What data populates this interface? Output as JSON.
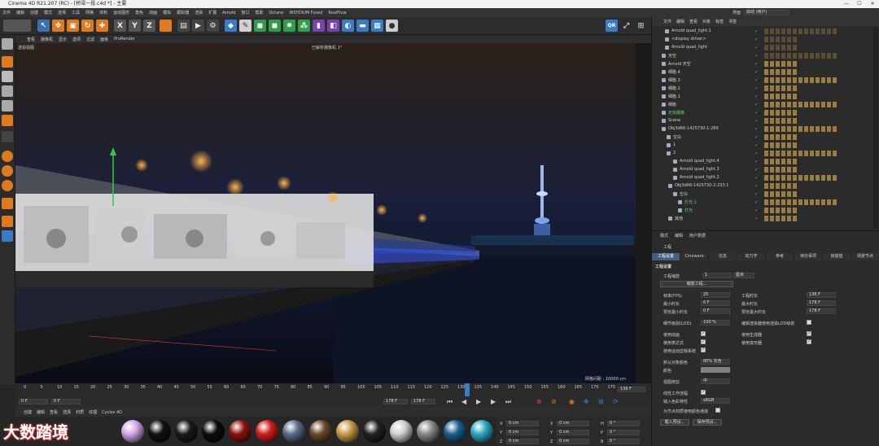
{
  "window": {
    "title": "Cinema 4D R21.207 (RC) - [桥梁一段.c4d *] - 主要",
    "controls": [
      "—",
      "☐",
      "✕"
    ]
  },
  "menubar": [
    "文件",
    "编辑",
    "创建",
    "模式",
    "选择",
    "工具",
    "网格",
    "体积",
    "运动图形",
    "角色",
    "动画",
    "模拟",
    "跟踪器",
    "渲染",
    "扩展",
    "Arnold",
    "窗口",
    "帮助",
    "Octane",
    "INSYDIUM Fused",
    "RealFlow"
  ],
  "layout": {
    "label": "界面",
    "value": "启动 (用户)"
  },
  "viewport": {
    "menu": [
      "查看",
      "摄像机",
      "显示",
      "选项",
      "过滤",
      "面板",
      "ProRender"
    ],
    "view_name": "透视视图",
    "camera_label": "已解析摄像机 1°",
    "grid_label": "网格间距 : 10000 cm"
  },
  "timeline": {
    "ticks": [
      "0",
      "5",
      "10",
      "15",
      "20",
      "25",
      "30",
      "35",
      "40",
      "45",
      "50",
      "55",
      "60",
      "65",
      "70",
      "75",
      "80",
      "85",
      "90",
      "95",
      "100",
      "105",
      "110",
      "115",
      "120",
      "125",
      "130",
      "135",
      "140",
      "145",
      "150",
      "155",
      "160",
      "165",
      "170",
      "175"
    ],
    "current_frame": "136 F"
  },
  "transport": {
    "start": "0 F",
    "start2": "0 F",
    "end": "178 F",
    "end2": "178 F"
  },
  "material_menu": [
    "创建",
    "编辑",
    "查看",
    "选择",
    "材质",
    "纹理",
    "Cycles 4D"
  ],
  "materials": [
    {
      "color": "#cfa8e6"
    },
    {
      "color": "#111"
    },
    {
      "color": "#1a1a1a"
    },
    {
      "color": "#0d0d0d"
    },
    {
      "color": "#8c1111"
    },
    {
      "color": "#d21e1e"
    },
    {
      "color": "#5a6d8a"
    },
    {
      "color": "#6a4a2a"
    },
    {
      "color": "#c89a44"
    },
    {
      "color": "#222"
    },
    {
      "color": "#d0d0d0"
    },
    {
      "color": "#888"
    },
    {
      "color": "#1b5f8f"
    },
    {
      "color": "#2aa9c4"
    }
  ],
  "coords": {
    "x": "X",
    "y": "Y",
    "z": "Z",
    "h": "H",
    "p": "P",
    "b": "B",
    "val": "0 cm",
    "angle": "0 °"
  },
  "watermark": "大数踏境",
  "object_manager": {
    "tabs": [
      "文件",
      "编辑",
      "查看",
      "对象",
      "标签",
      "书签"
    ],
    "rows": [
      {
        "name": "Arnold quad_light.1",
        "indent": 10,
        "green": false
      },
      {
        "name": "<display driver>",
        "indent": 10,
        "green": false
      },
      {
        "name": "Arnold quad_light",
        "indent": 10,
        "green": false
      },
      {
        "name": "天空",
        "indent": 6,
        "green": false
      },
      {
        "name": "Arnold 天空",
        "indent": 6,
        "green": false
      },
      {
        "name": "细胞.4",
        "indent": 6,
        "green": false
      },
      {
        "name": "细胞.3",
        "indent": 6,
        "green": false
      },
      {
        "name": "细胞.2",
        "indent": 6,
        "green": false
      },
      {
        "name": "细胞.1",
        "indent": 6,
        "green": false
      },
      {
        "name": "细胞",
        "indent": 6,
        "green": false
      },
      {
        "name": "无标摄像",
        "indent": 6,
        "green": true
      },
      {
        "name": "Scene",
        "indent": 6,
        "green": false
      },
      {
        "name": "Obj3d66-1425730-1-289",
        "indent": 6,
        "green": false
      },
      {
        "name": "空白",
        "indent": 12,
        "green": false
      },
      {
        "name": "1",
        "indent": 12,
        "green": false
      },
      {
        "name": "2",
        "indent": 12,
        "green": false
      },
      {
        "name": "Arnold quad_light.4",
        "indent": 20,
        "green": false
      },
      {
        "name": "Arnold quad_light.3",
        "indent": 20,
        "green": false
      },
      {
        "name": "Arnold quad_light.2",
        "indent": 20,
        "green": false
      },
      {
        "name": "Obj3d66-1425730-2-233.1",
        "indent": 14,
        "green": false
      },
      {
        "name": "空白",
        "indent": 20,
        "green": false
      },
      {
        "name": "灯光.1",
        "indent": 26,
        "green": true
      },
      {
        "name": "灯光",
        "indent": 26,
        "green": true
      },
      {
        "name": "其他",
        "indent": 14,
        "green": false
      }
    ]
  },
  "attributes": {
    "menu": [
      "模式",
      "编辑",
      "用户数据"
    ],
    "title": "工程",
    "tabs": [
      "工程设置",
      "Cineware",
      "信息",
      "动力学",
      "参考",
      "待办事项",
      "帧插值",
      "场景节点"
    ],
    "section": "工程设置",
    "fields": {
      "scale_label": "工程缩放",
      "scale_value": "1",
      "scale_unit": "厘米",
      "scale_btn": "缩放工程...",
      "fps_label": "帧率(FPS)",
      "fps_value": "25",
      "time_label": "工程时长",
      "time_value": "136 F",
      "min_label": "最小时长",
      "min_value": "0 F",
      "max_label": "最大时长",
      "max_value": "178 F",
      "pmin_label": "预览最小时长",
      "pmin_value": "0 F",
      "pmax_label": "预览最大时长",
      "pmax_value": "178 F",
      "lod_label": "细节级别(LOD)",
      "lod_value": "100 %",
      "lod_check": "编辑渲染器使用渲染LOD级别",
      "anim_label": "使用动画",
      "expr_label": "使用表达式",
      "gen_label": "使用生成器",
      "deform_label": "使用变形器",
      "motion_label": "使用运动剪辑系统",
      "color_label": "默认对象颜色",
      "color_value": "80% 灰色",
      "color2_label": "颜色",
      "view_label": "视图修剪",
      "view_value": "中",
      "linear_label": "线性工作流程",
      "profile_label": "输入色彩特性",
      "profile_value": "sRGB",
      "alpha_label": "为节点材质使用颜色通道",
      "btn_load": "载入预设...",
      "btn_save": "保存预设..."
    }
  }
}
